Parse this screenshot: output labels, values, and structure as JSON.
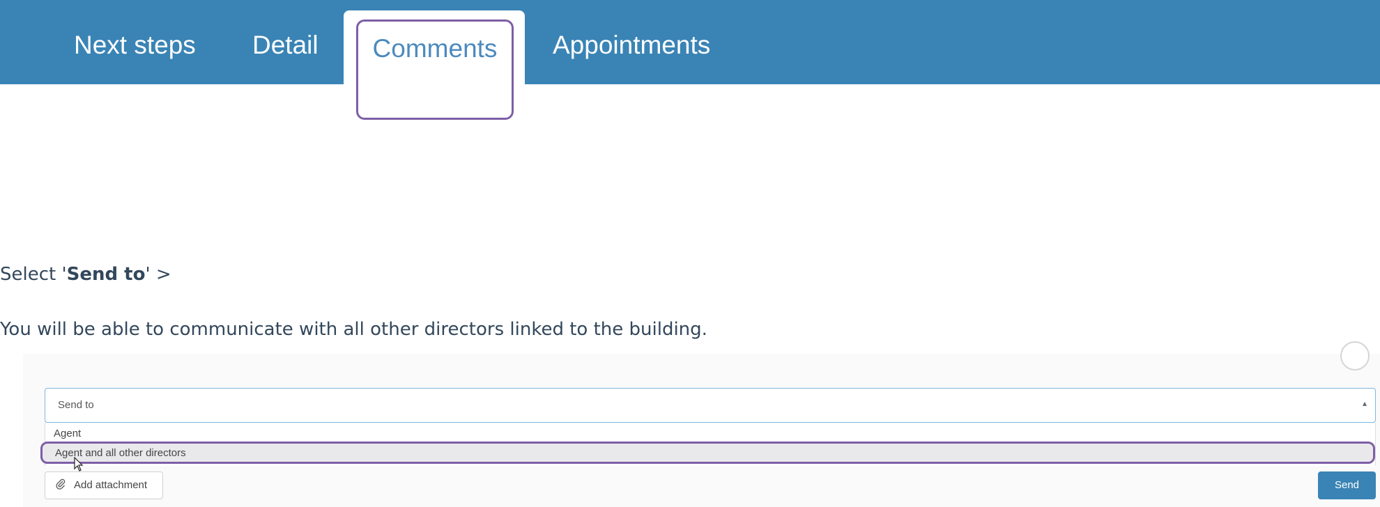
{
  "tabs": {
    "next_steps": "Next steps",
    "detail": "Detail",
    "comments": "Comments",
    "appointments": "Appointments",
    "active": "Comments"
  },
  "instructions": {
    "line1_prefix": "Select '",
    "line1_bold": "Send to",
    "line1_suffix": "' >",
    "line2": "You will be able to communicate with all other directors linked to the building."
  },
  "send_to": {
    "placeholder": "Send to",
    "options": [
      "Agent",
      "Agent and all other directors"
    ],
    "highlighted_option": "Agent and all other directors"
  },
  "actions": {
    "add_attachment": "Add attachment",
    "send": "Send"
  },
  "icons": {
    "attachment": "paperclip-icon",
    "dropdown": "chevron-up-icon",
    "cursor": "mouse-pointer-icon"
  },
  "colors": {
    "tab_bar": "#3a84b5",
    "highlight": "#7d5ea6",
    "send_button": "#3a84b5"
  }
}
